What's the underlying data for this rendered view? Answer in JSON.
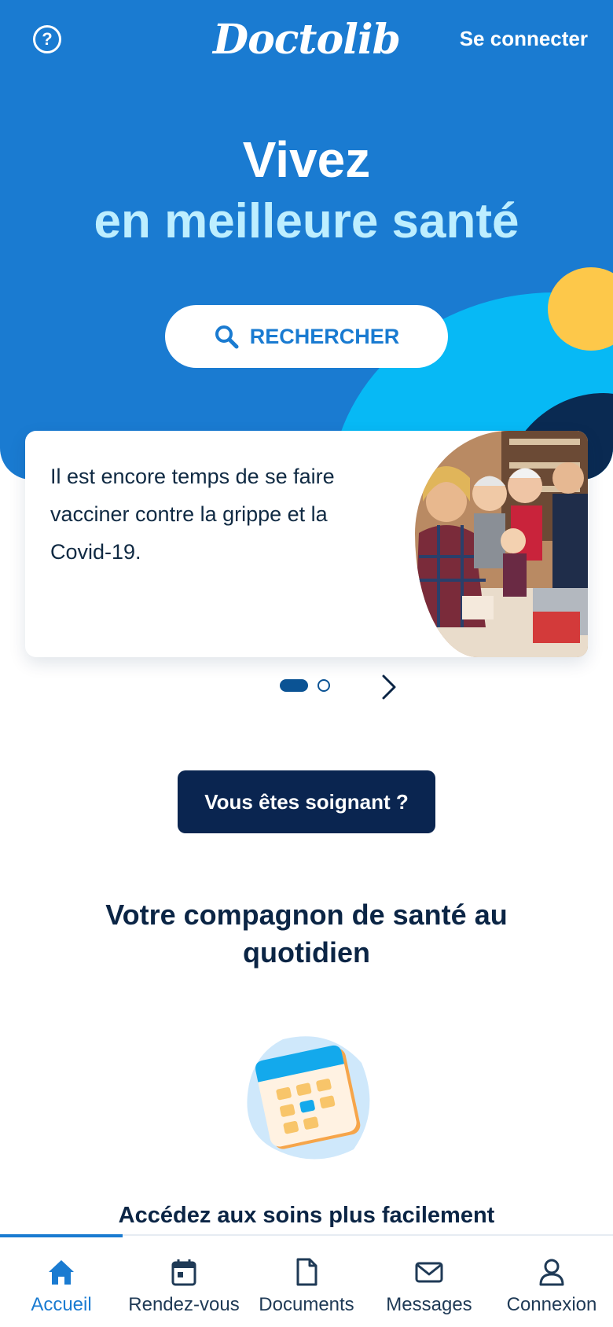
{
  "header": {
    "logo_text": "Doctolib",
    "connect_label": "Se connecter",
    "help_icon": "help-circle-icon"
  },
  "hero": {
    "title_line1": "Vivez",
    "title_line2": "en meilleure santé",
    "search_label": "RECHERCHER"
  },
  "carousel": {
    "card_text": "Il est encore temps de se faire vacciner contre la grippe et la Covid-19.",
    "active_index": 1,
    "total": 2
  },
  "pro_button": "Vous êtes soignant ?",
  "section": {
    "title": "Votre compagnon de santé au quotidien",
    "feature_title": "Accédez aux soins plus facilement"
  },
  "tabbar": {
    "items": [
      {
        "label": "Accueil",
        "icon": "home-icon",
        "active": true
      },
      {
        "label": "Rendez-vous",
        "icon": "calendar-icon",
        "active": false
      },
      {
        "label": "Documents",
        "icon": "document-icon",
        "active": false
      },
      {
        "label": "Messages",
        "icon": "mail-icon",
        "active": false
      },
      {
        "label": "Connexion",
        "icon": "user-icon",
        "active": false
      }
    ]
  },
  "colors": {
    "primary": "#1a7bd1",
    "navy": "#0a2550",
    "cyan": "#07b9f5",
    "yellow": "#fdc84a",
    "light_blue_text": "#bdeeff"
  }
}
